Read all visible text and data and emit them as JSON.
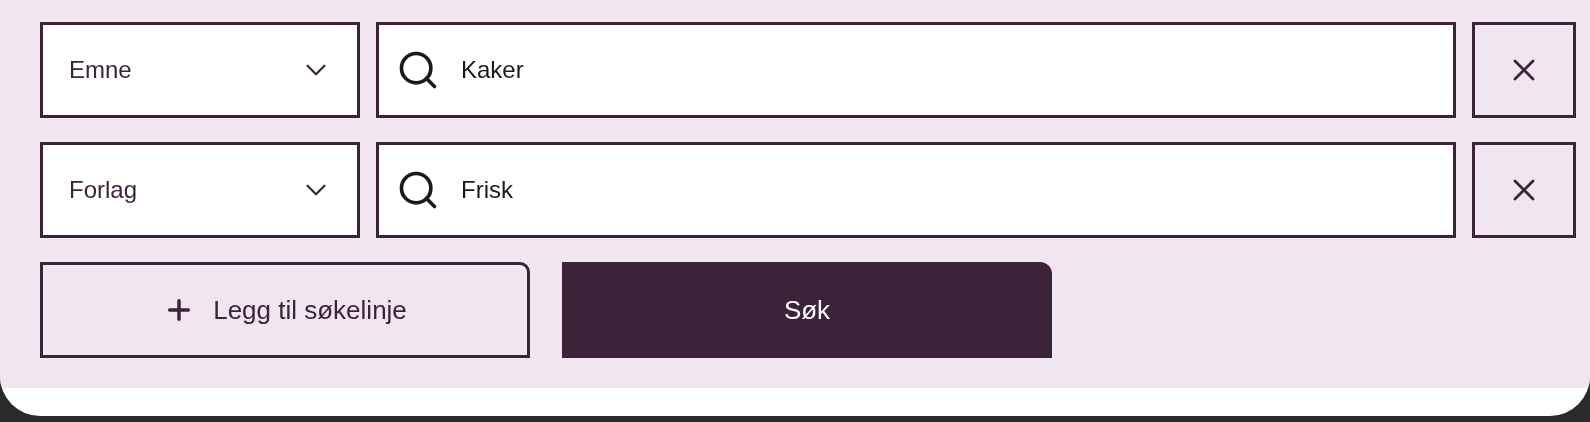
{
  "search_rows": [
    {
      "field": "Emne",
      "query": "Kaker"
    },
    {
      "field": "Forlag",
      "query": "Frisk"
    }
  ],
  "add_button": "Legg til søkelinje",
  "search_button": "Søk"
}
